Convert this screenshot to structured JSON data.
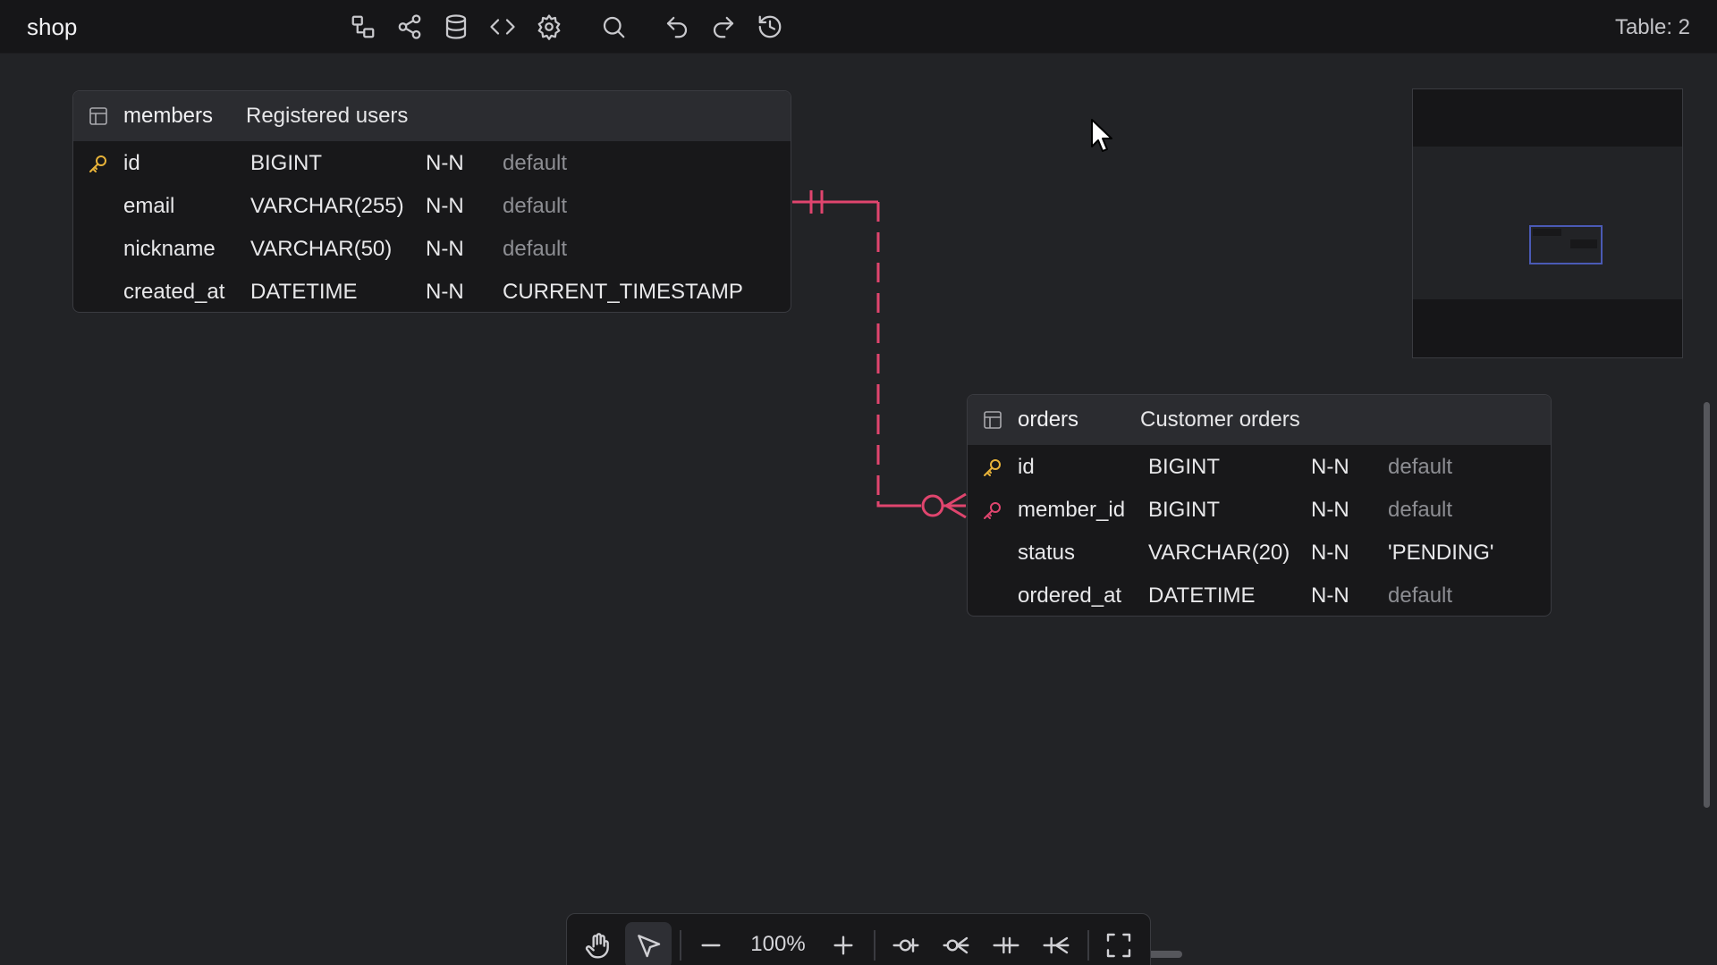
{
  "app": {
    "title": "shop",
    "table_count": "Table: 2"
  },
  "toolbar_top": {
    "icons": [
      "diagram-icon",
      "share-icon",
      "database-icon",
      "code-icon",
      "settings-icon",
      "search-icon",
      "undo-icon",
      "redo-icon",
      "history-icon"
    ]
  },
  "colors": {
    "relation": "#e0456e",
    "primary_key": "#e8b339",
    "foreign_key": "#e0456e",
    "minimap_view": "#4a5ab5"
  },
  "tables": [
    {
      "name": "members",
      "comment": "Registered users",
      "columns": [
        {
          "key": "primary",
          "name": "id",
          "type": "BIGINT",
          "null": "N-N",
          "default": "default"
        },
        {
          "key": "",
          "name": "email",
          "type": "VARCHAR(255)",
          "null": "N-N",
          "default": "default"
        },
        {
          "key": "",
          "name": "nickname",
          "type": "VARCHAR(50)",
          "null": "N-N",
          "default": "default"
        },
        {
          "key": "",
          "name": "created_at",
          "type": "DATETIME",
          "null": "N-N",
          "default": "CURRENT_TIMESTAMP"
        }
      ]
    },
    {
      "name": "orders",
      "comment": "Customer orders",
      "columns": [
        {
          "key": "primary",
          "name": "id",
          "type": "BIGINT",
          "null": "N-N",
          "default": "default"
        },
        {
          "key": "foreign",
          "name": "member_id",
          "type": "BIGINT",
          "null": "N-N",
          "default": "default"
        },
        {
          "key": "",
          "name": "status",
          "type": "VARCHAR(20)",
          "null": "N-N",
          "default": "'PENDING'"
        },
        {
          "key": "",
          "name": "ordered_at",
          "type": "DATETIME",
          "null": "N-N",
          "default": "default"
        }
      ]
    }
  ],
  "relationship": {
    "from": "members.id",
    "to": "orders.member_id",
    "cardinality": "one-to-zero-or-many"
  },
  "bottom_toolbar": {
    "zoom": "100%",
    "tools": [
      "hand-icon",
      "pointer-icon",
      "zoom-out-icon",
      "zoom-in-icon",
      "zero-one-icon",
      "zero-many-icon",
      "one-only-icon",
      "one-many-icon",
      "fullscreen-icon"
    ]
  }
}
